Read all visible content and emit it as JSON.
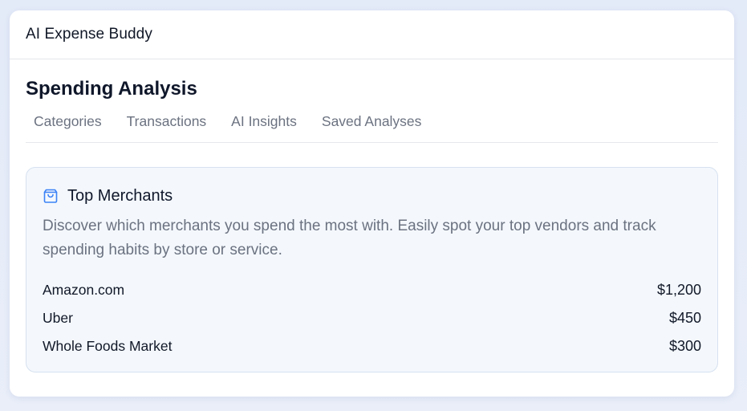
{
  "app": {
    "title": "AI Expense Buddy"
  },
  "page": {
    "title": "Spending Analysis"
  },
  "tabs": [
    {
      "label": "Categories"
    },
    {
      "label": "Transactions"
    },
    {
      "label": "AI Insights"
    },
    {
      "label": "Saved Analyses"
    }
  ],
  "panel": {
    "icon": "shopping-bag-icon",
    "title": "Top Merchants",
    "description": "Discover which merchants you spend the most with. Easily spot your top vendors and track spending habits by store or service.",
    "merchants": [
      {
        "name": "Amazon.com",
        "amount": "$1,200"
      },
      {
        "name": "Uber",
        "amount": "$450"
      },
      {
        "name": "Whole Foods Market",
        "amount": "$300"
      }
    ]
  },
  "colors": {
    "accent": "#3b82f6",
    "panel_background": "#f4f8fd",
    "muted_text": "#6b7280"
  }
}
